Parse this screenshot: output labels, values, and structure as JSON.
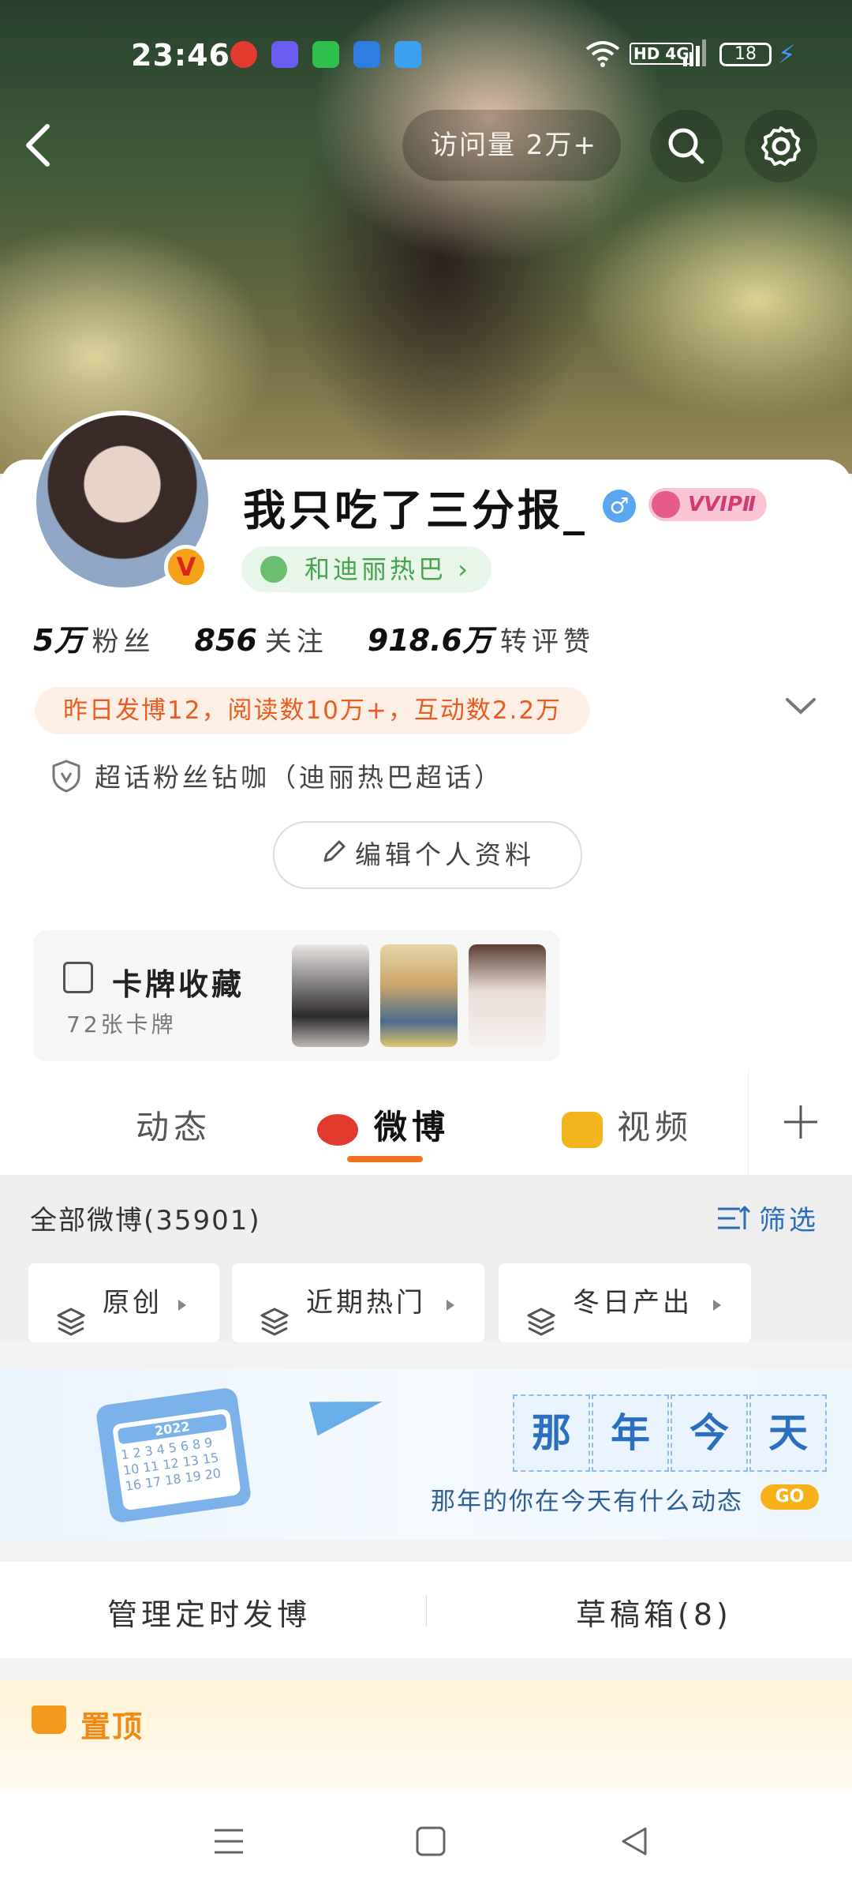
{
  "status_bar": {
    "time": "23:46",
    "network": "HD 4G",
    "battery": "18"
  },
  "header": {
    "visit_text": "访问量 2万+"
  },
  "profile": {
    "name": "我只吃了三分报_",
    "gender_symbol": "♂",
    "vip_label": "VVIPⅡ",
    "fan_club": "和迪丽热巴 ›",
    "verified_symbol": "V"
  },
  "stats": [
    {
      "value": "5万",
      "label": "粉丝"
    },
    {
      "value": "856",
      "label": "关注"
    },
    {
      "value": "918.6万",
      "label": "转评赞"
    }
  ],
  "daily_summary": "昨日发博12，阅读数10万+，互动数2.2万",
  "super_fan": "超话粉丝钻咖（迪丽热巴超话）",
  "edit_profile": "编辑个人资料",
  "card_collection": {
    "title": "卡牌收藏",
    "subtitle": "72张卡牌"
  },
  "tabs": [
    {
      "label": "动态"
    },
    {
      "label": "微博"
    },
    {
      "label": "视频"
    }
  ],
  "feed_header": {
    "all_weibo": "全部微博(35901)",
    "filter": "筛选"
  },
  "chips": [
    "原创",
    "近期热门",
    "冬日产出"
  ],
  "banner": {
    "title_chars": [
      "那",
      "年",
      "今",
      "天"
    ],
    "subtitle": "那年的你在今天有什么动态",
    "go": "GO",
    "calendar_year": "2022",
    "calendar_nums": "1 2 3 4 5 6 8 9 10 11 12 13 15 16 17 18 19 20"
  },
  "manage": {
    "scheduled": "管理定时发博",
    "drafts": "草稿箱(8)"
  },
  "pinned_label": "置顶",
  "colors": {
    "accent": "#f3721c",
    "link": "#2b6dbb",
    "green": "#49a24f"
  }
}
